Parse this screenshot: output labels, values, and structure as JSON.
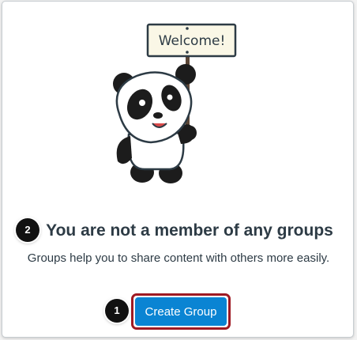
{
  "illustration": {
    "sign_text": "Welcome!"
  },
  "empty_state": {
    "heading": "You are not a member of any groups",
    "description": "Groups help you to share content with others more easily."
  },
  "actions": {
    "create_group_label": "Create Group"
  },
  "callouts": {
    "heading_callout": "2",
    "button_callout": "1"
  },
  "colors": {
    "primary_button": "#0a84d3",
    "callout_highlight": "#9f1a23",
    "text": "#2d3b45"
  },
  "icons": [
    "panda-illustration"
  ]
}
